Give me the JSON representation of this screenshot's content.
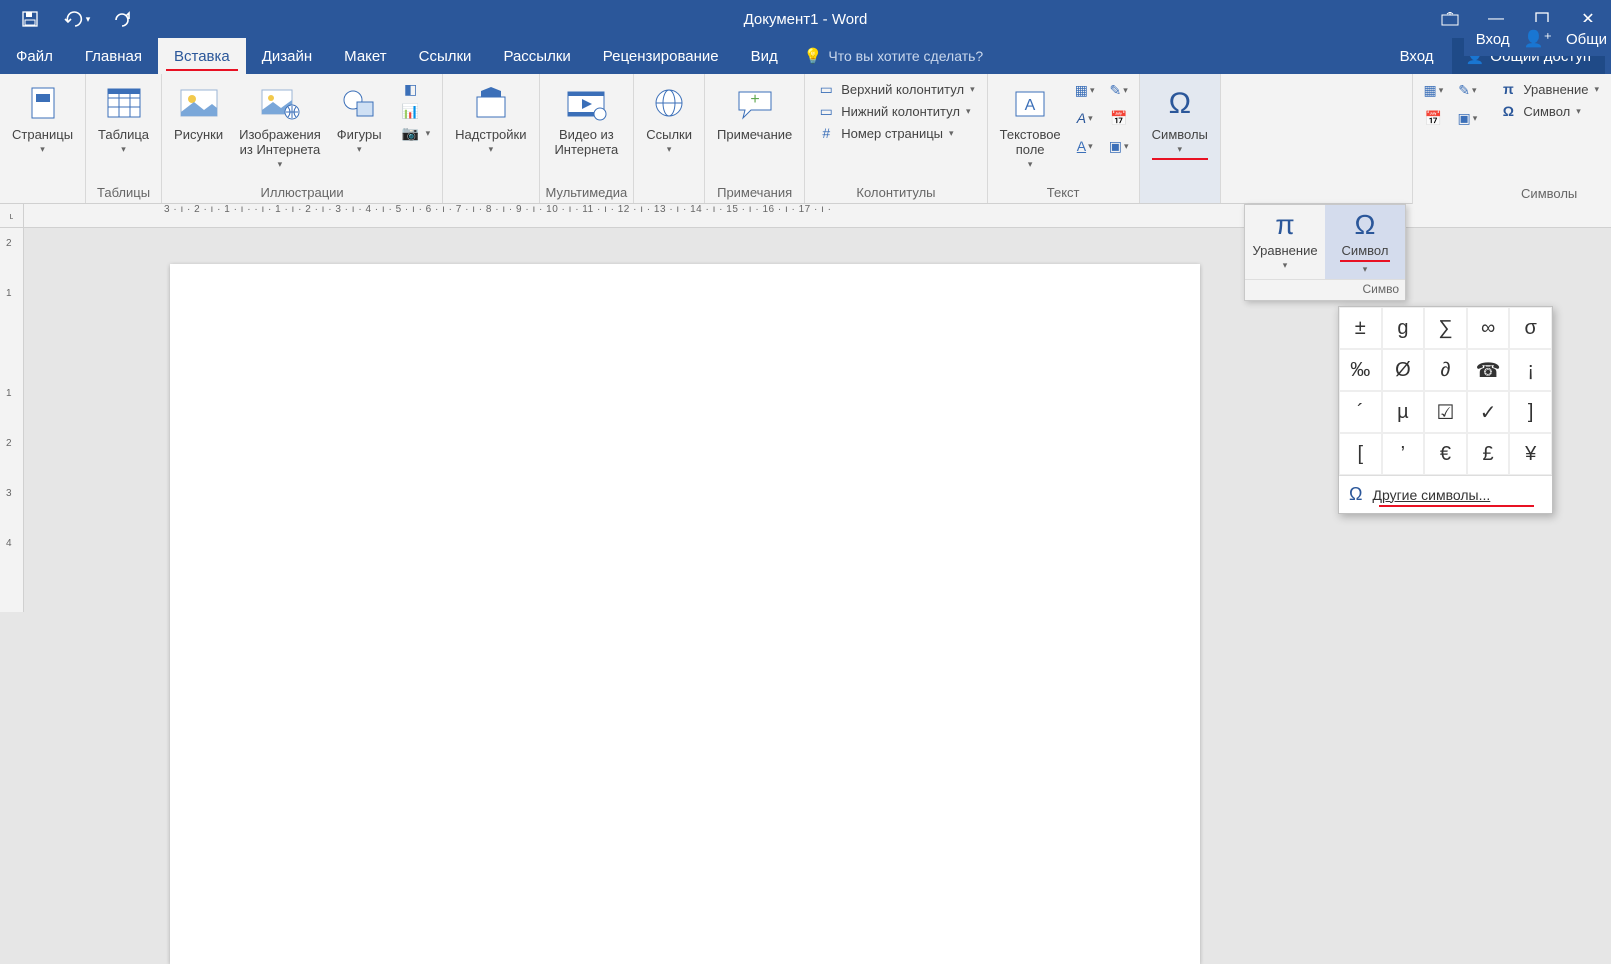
{
  "title": "Документ1 - Word",
  "qat": {
    "save": "save",
    "undo": "undo",
    "redo": "redo"
  },
  "window": {
    "ribbon_display": "ribbon-display",
    "minimize": "—",
    "maximize": "▢",
    "close": "✕"
  },
  "extra_right": {
    "login": "Вход",
    "share": "Общи"
  },
  "tabs": {
    "items": [
      "Файл",
      "Главная",
      "Вставка",
      "Дизайн",
      "Макет",
      "Ссылки",
      "Рассылки",
      "Рецензирование",
      "Вид"
    ],
    "active_index": 2,
    "tell_me": "Что вы хотите сделать?",
    "login": "Вход",
    "share": "Общий доступ"
  },
  "ribbon": {
    "pages": {
      "label": "Страницы",
      "group": ""
    },
    "tables": {
      "label": "Таблица",
      "group": "Таблицы"
    },
    "illustrations": {
      "pictures": "Рисунки",
      "online_pictures": "Изображения\nиз Интернета",
      "shapes": "Фигуры",
      "group": "Иллюстрации"
    },
    "addins": {
      "label": "Надстройки",
      "group": ""
    },
    "media": {
      "label": "Видео из\nИнтернета",
      "group": "Мультимедиа"
    },
    "links": {
      "label": "Ссылки",
      "group": ""
    },
    "comments": {
      "label": "Примечание",
      "group": "Примечания"
    },
    "header_footer": {
      "header": "Верхний колонтитул",
      "footer": "Нижний колонтитул",
      "page_number": "Номер страницы",
      "group": "Колонтитулы"
    },
    "text": {
      "textbox": "Текстовое\nполе",
      "group": "Текст"
    },
    "symbols": {
      "label": "Символы",
      "group": ""
    },
    "far_right": {
      "equation": "Уравнение",
      "symbol": "Символ",
      "group": "Символы"
    }
  },
  "ruler": {
    "horizontal": "3 · ı · 2 · ı · 1 · ı ·   · ı · 1 · ı · 2 · ı · 3 · ı · 4 · ı · 5 · ı · 6 · ı · 7 · ı · 8 · ı · 9 · ı · 10 · ı · 11 · ı · 12 · ı · 13 · ı · 14 · ı · 15 · ı · 16 · ı · 17 · ı ·",
    "corner": "ʟ",
    "vertical": [
      "2",
      "1",
      "1",
      "2",
      "3",
      "4"
    ]
  },
  "popup": {
    "equation": "Уравнение",
    "symbol": "Символ",
    "group": "Симво"
  },
  "symbol_grid": {
    "cells": [
      "±",
      "g",
      "∑",
      "∞",
      "σ",
      "‰",
      "Ø",
      "∂",
      "☎",
      "¡",
      "´",
      "µ",
      "☑",
      "✓",
      "]",
      "[",
      "’",
      "€",
      "£",
      "¥"
    ],
    "more": "Другие символы..."
  }
}
